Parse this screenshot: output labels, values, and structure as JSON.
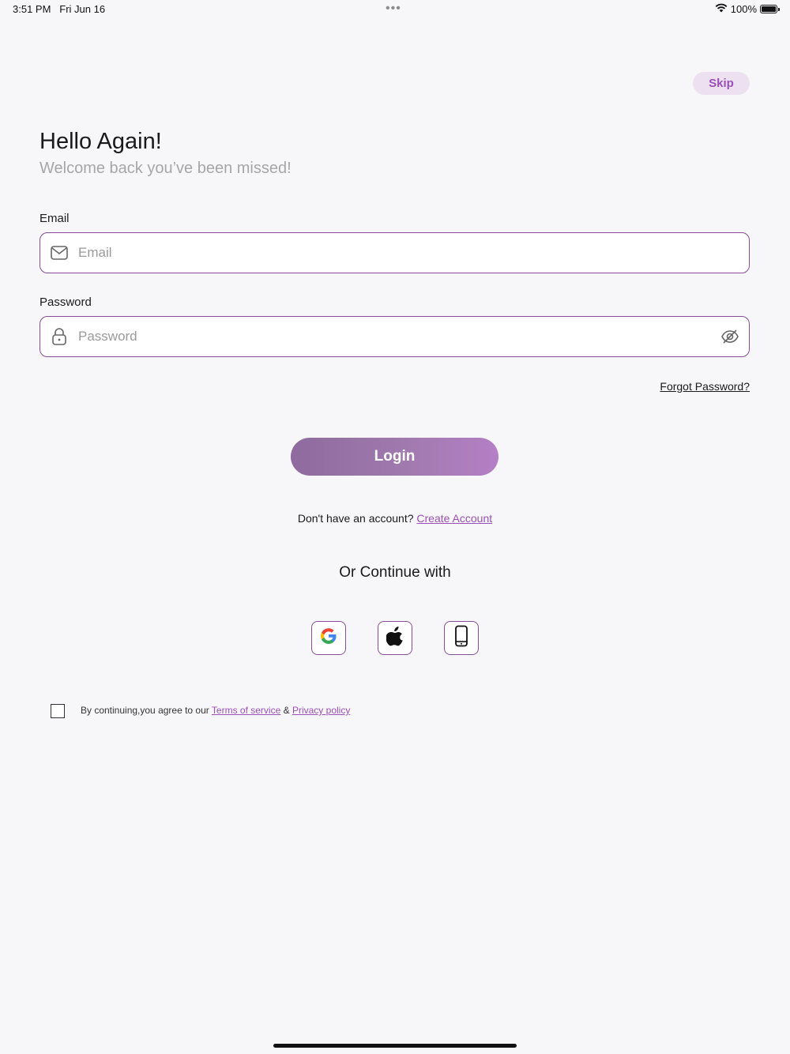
{
  "status_bar": {
    "time": "3:51 PM",
    "date": "Fri Jun 16",
    "dots": "•••",
    "battery_percent": "100%",
    "icons": [
      "wifi-icon",
      "battery-icon"
    ]
  },
  "header": {
    "skip_label": "Skip",
    "title": "Hello Again!",
    "subtitle": "Welcome back you’ve been missed!"
  },
  "form": {
    "email": {
      "label": "Email",
      "placeholder": "Email",
      "value": "",
      "icon": "mail-icon"
    },
    "password": {
      "label": "Password",
      "placeholder": "Password",
      "value": "",
      "icon": "lock-icon",
      "toggle_icon": "eye-off-icon"
    },
    "forgot_password": "Forgot Password?",
    "login_label": "Login"
  },
  "signup": {
    "prompt": "Don't have an account?",
    "link": "Create Account"
  },
  "social": {
    "heading": "Or Continue with",
    "providers": [
      "google-icon",
      "apple-icon",
      "phone-icon"
    ]
  },
  "terms": {
    "prefix": "By continuing,you agree to our",
    "terms_link": "Terms of service",
    "separator": "&",
    "privacy_link": "Privacy policy",
    "checked": false
  },
  "colors": {
    "accent": "#9b4fb8",
    "border": "#8a4c99",
    "skip_bg": "#ece0f1",
    "background": "#f7f7f9"
  }
}
